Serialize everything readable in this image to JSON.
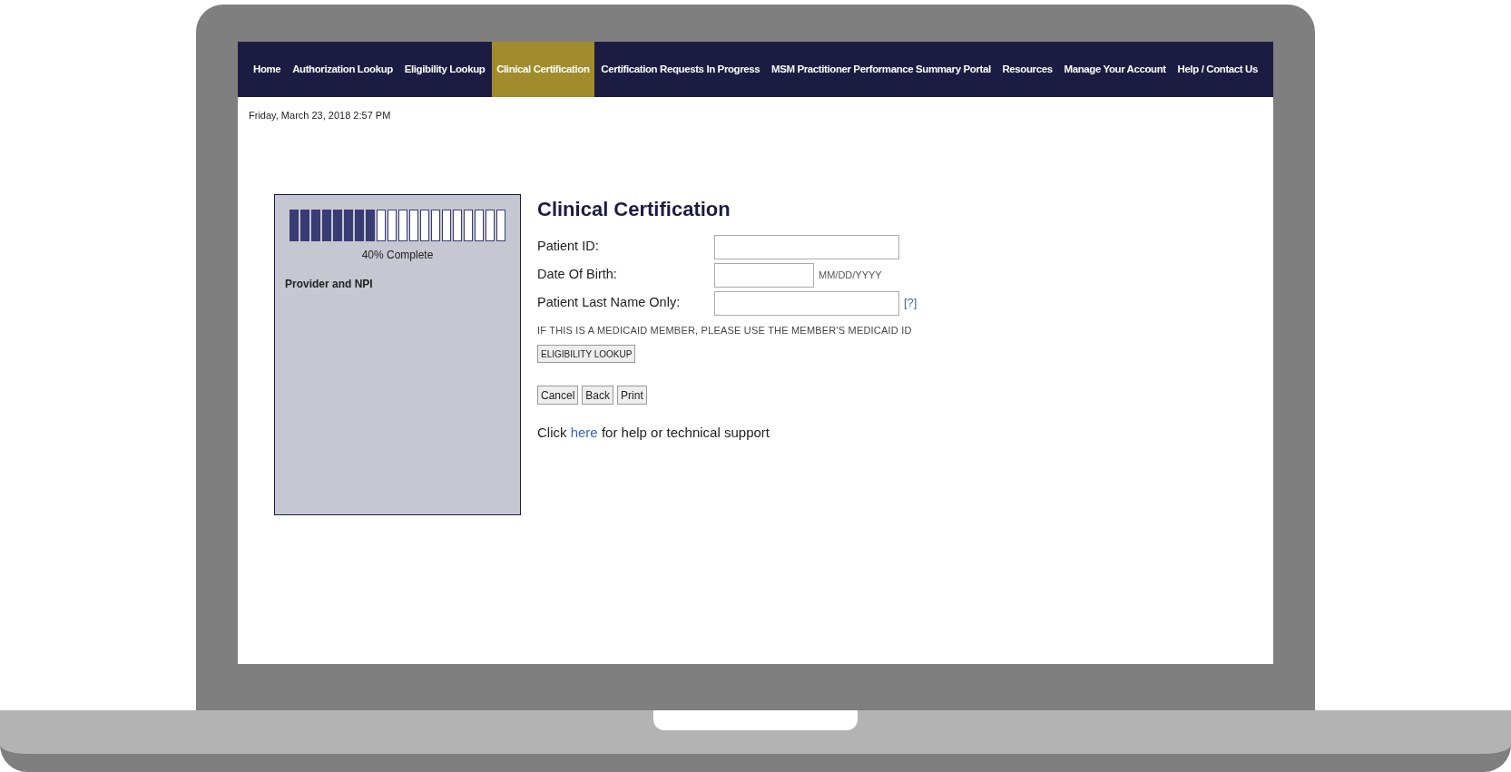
{
  "nav": [
    {
      "label": "Home",
      "selected": false
    },
    {
      "label": "Authorization Lookup",
      "selected": false
    },
    {
      "label": "Eligibility Lookup",
      "selected": false
    },
    {
      "label": "Clinical Certification",
      "selected": true
    },
    {
      "label": "Certification Requests In Progress",
      "selected": false
    },
    {
      "label": "MSM Practitioner Performance Summary Portal",
      "selected": false
    },
    {
      "label": "Resources",
      "selected": false
    },
    {
      "label": "Manage Your Account",
      "selected": false
    },
    {
      "label": "Help / Contact Us",
      "selected": false
    }
  ],
  "datetime": "Friday, March 23, 2018 2:57 PM",
  "progress": {
    "level": 0.4,
    "reading": "40% Complete",
    "step": "Provider and NPI"
  },
  "form": {
    "title": "Clinical Certification",
    "fields": [
      {
        "label": "Patient ID:",
        "kind": "long"
      },
      {
        "label": "Date Of Birth:",
        "kind": "short",
        "hint": "MM/DD/YYYY"
      },
      {
        "label": "Patient Last Name Only:",
        "kind": "long",
        "help": "[?]"
      }
    ],
    "notice": "IF THIS IS A MEDICAID MEMBER, PLEASE USE THE MEMBER'S MEDICAID ID",
    "lookup_button": "ELIGIBILITY LOOKUP",
    "buttons": [
      "Cancel",
      "Back",
      "Print"
    ],
    "help": {
      "before": "Click",
      "link": "here",
      "after": "for help or technical support"
    }
  }
}
